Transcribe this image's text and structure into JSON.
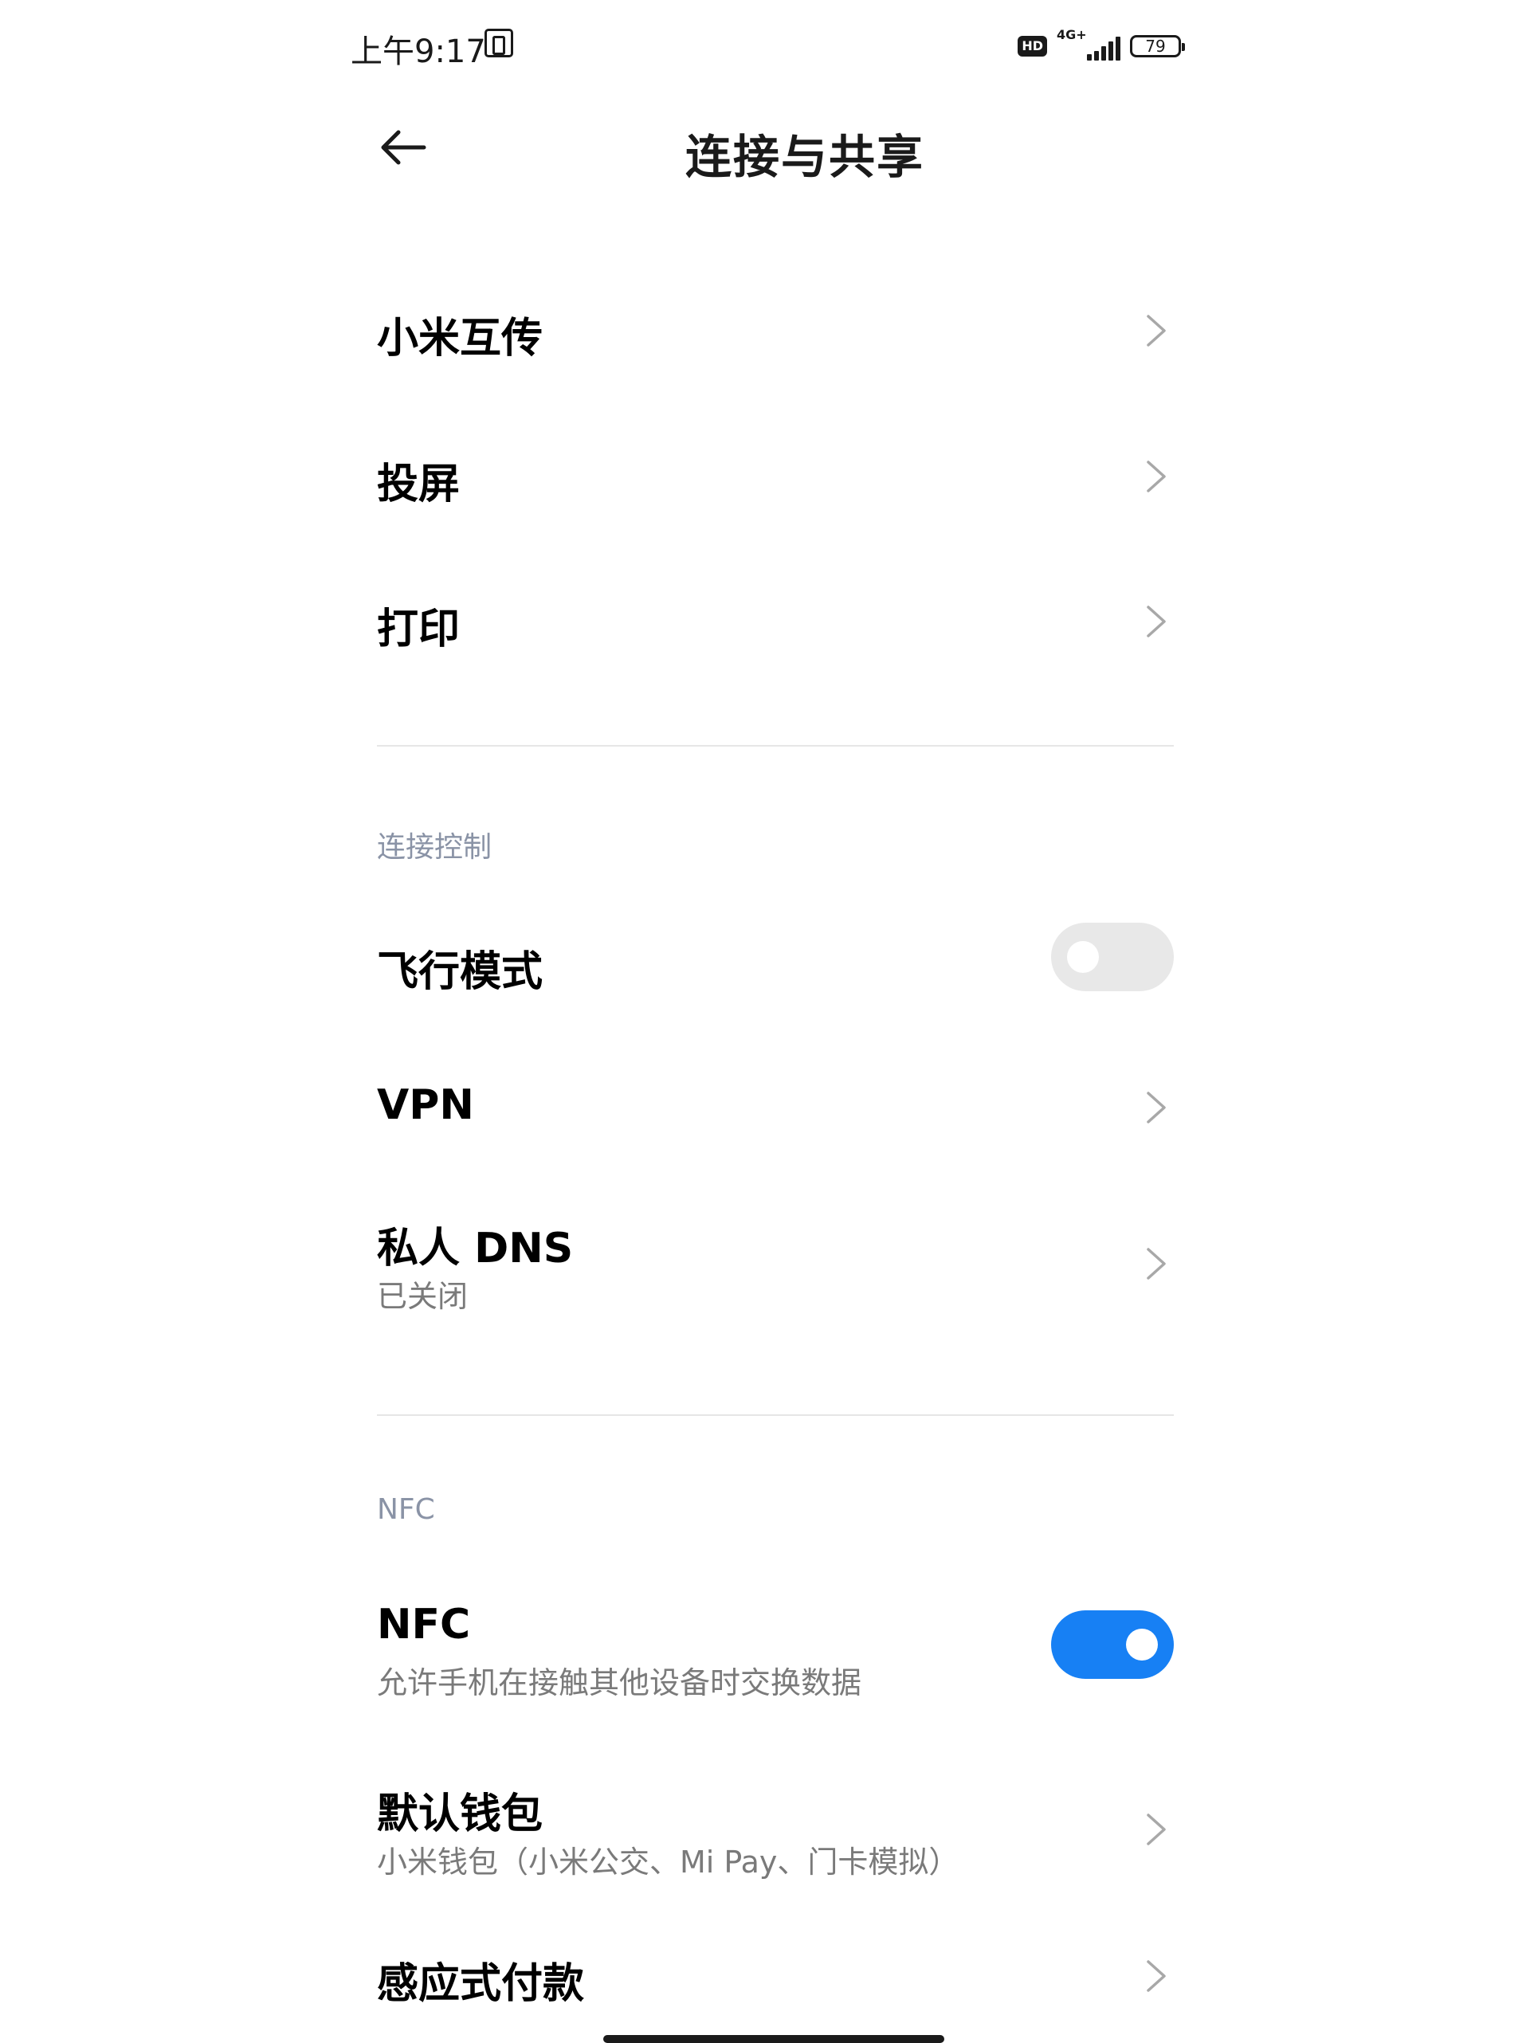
{
  "status_bar": {
    "time": "上午9:17",
    "hd_label": "HD",
    "network_type": "4G+",
    "battery_level": "79"
  },
  "header": {
    "title": "连接与共享"
  },
  "items": {
    "mi_share": {
      "title": "小米互传"
    },
    "cast": {
      "title": "投屏"
    },
    "print": {
      "title": "打印"
    },
    "airplane": {
      "title": "飞行模式",
      "enabled": false
    },
    "vpn": {
      "title": "VPN"
    },
    "private_dns": {
      "title": "私人 DNS",
      "subtitle": "已关闭"
    },
    "nfc": {
      "title": "NFC",
      "subtitle": "允许手机在接触其他设备时交换数据",
      "enabled": true
    },
    "default_wallet": {
      "title": "默认钱包",
      "subtitle": "小米钱包（小米公交、Mi Pay、门卡模拟）"
    },
    "tap_to_pay": {
      "title": "感应式付款"
    }
  },
  "sections": {
    "connection_control": "连接控制",
    "nfc": "NFC"
  },
  "colors": {
    "accent": "#1780f4",
    "toggle_off": "#e8e8e8",
    "section_label": "#8a93a6",
    "subtitle": "#7a7a7a",
    "divider": "#e6e6e6"
  },
  "icons": {
    "back": "arrow-left-icon",
    "chevron": "chevron-right-icon",
    "status_nfc": "nfc-icon",
    "signal": "signal-icon",
    "battery": "battery-icon"
  }
}
